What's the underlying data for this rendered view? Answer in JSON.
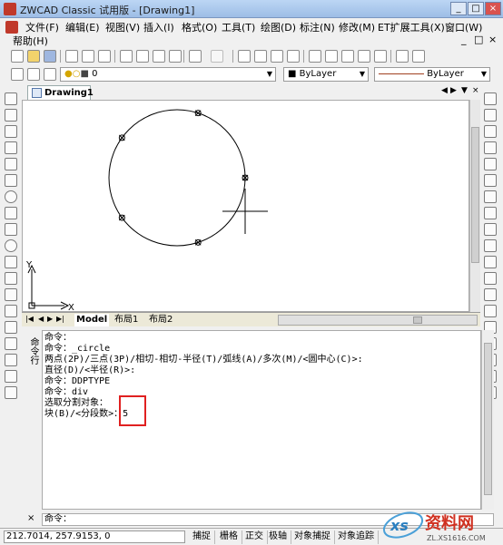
{
  "app": {
    "title": "ZWCAD Classic 试用版 - [Drawing1]",
    "window_buttons": [
      "_",
      "□",
      "×"
    ]
  },
  "menubar": {
    "items_row1": [
      "文件(F)",
      "编辑(E)",
      "视图(V)",
      "插入(I)",
      "格式(O)",
      "工具(T)",
      "绘图(D)",
      "标注(N)",
      "修改(M)",
      "ET扩展工具(X)",
      "窗口(W)"
    ],
    "items_row2": [
      "帮助(H)"
    ],
    "mdi_buttons": [
      "_",
      "□",
      "×"
    ]
  },
  "toolbar2": {
    "layer_value": "0",
    "color_value": "ByLayer",
    "linetype_value": "ByLayer"
  },
  "document": {
    "tab_label": "Drawing1",
    "tab_controls": [
      "◀",
      "▶",
      "▼",
      "×"
    ]
  },
  "layouts": {
    "nav": [
      "|◀",
      "◀",
      "▶",
      "▶|"
    ],
    "tabs": [
      "Model",
      "布局1",
      "布局2"
    ]
  },
  "ucs": {
    "x_label": "X",
    "y_label": "Y"
  },
  "command": {
    "side_label": "命令行",
    "history": [
      "命令：",
      "命令：_circle",
      "两点(2P)/三点(3P)/相切-相切-半径(T)/弧线(A)/多次(M)/<圆中心(C)>:",
      "直径(D)/<半径(R)>:",
      "命令：DDPTYPE",
      "命令：div",
      "选取分割对象：",
      "块(B)/<分段数>：5"
    ],
    "prompt": "命令：",
    "close": "×"
  },
  "statusbar": {
    "coords": "212.7014,  257.9153,  0",
    "buttons": [
      "捕捉",
      "栅格",
      "正交",
      "极轴",
      "对象捕捉",
      "对象追踪"
    ]
  },
  "watermark": {
    "text": "资料网",
    "url": "ZL.XS1616.COM"
  },
  "colors": {
    "title_gradient_top": "#bcd6f4",
    "annotation_red": "#e02020",
    "canvas_bg": "#ffffff"
  }
}
